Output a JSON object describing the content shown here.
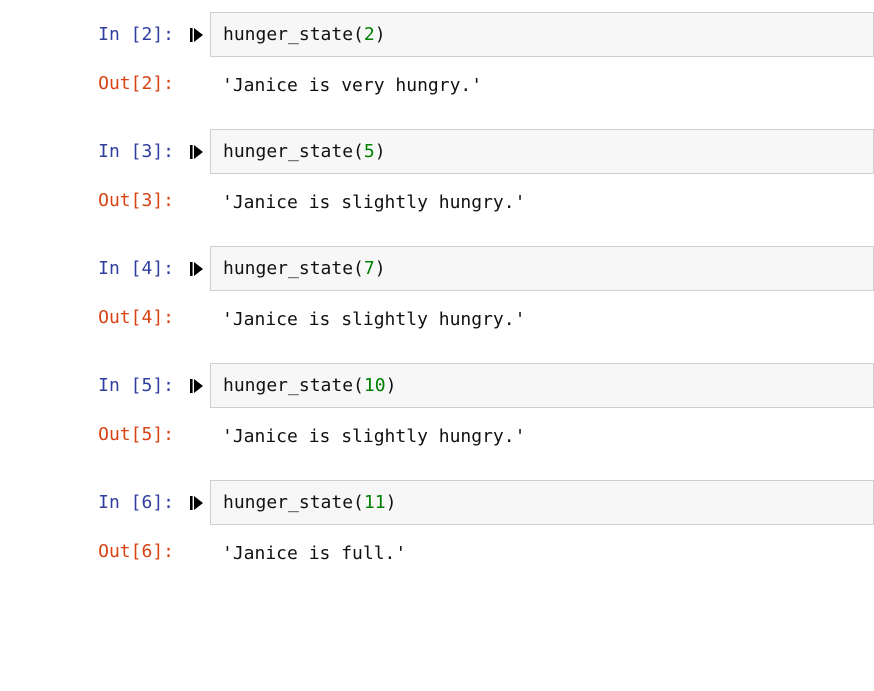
{
  "cells": [
    {
      "exec_count": 2,
      "fn": "hunger_state",
      "arg": "2",
      "output": "'Janice is very hungry.'"
    },
    {
      "exec_count": 3,
      "fn": "hunger_state",
      "arg": "5",
      "output": "'Janice is slightly hungry.'"
    },
    {
      "exec_count": 4,
      "fn": "hunger_state",
      "arg": "7",
      "output": "'Janice is slightly hungry.'"
    },
    {
      "exec_count": 5,
      "fn": "hunger_state",
      "arg": "10",
      "output": "'Janice is slightly hungry.'"
    },
    {
      "exec_count": 6,
      "fn": "hunger_state",
      "arg": "11",
      "output": "'Janice is full.'"
    }
  ],
  "labels": {
    "in_prefix": "In [",
    "in_suffix": "]:",
    "out_prefix": "Out[",
    "out_suffix": "]:",
    "open_paren": "(",
    "close_paren": ")"
  }
}
